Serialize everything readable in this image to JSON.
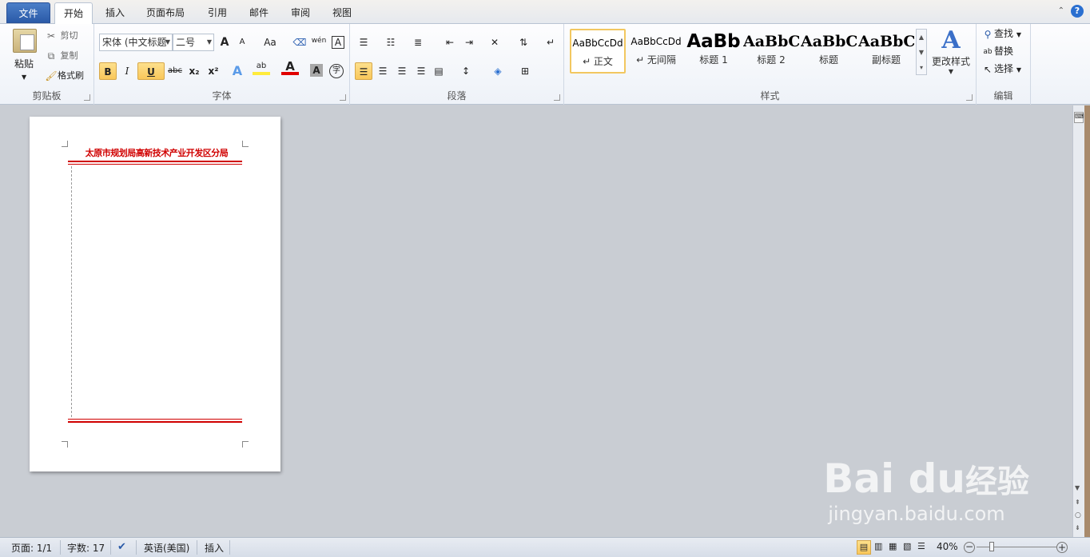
{
  "tabs": [
    "文件",
    "开始",
    "插入",
    "页面布局",
    "引用",
    "邮件",
    "审阅",
    "视图"
  ],
  "clipboard": {
    "paste": "粘贴",
    "cut": "剪切",
    "copy": "复制",
    "format_painter": "格式刷",
    "label": "剪贴板"
  },
  "font": {
    "name": "宋体 (中文标题",
    "size": "二号",
    "label": "字体",
    "grow": "A",
    "shrink": "A",
    "case": "Aa",
    "bold": "B",
    "italic": "I",
    "underline": "U",
    "strike": "abc",
    "sub": "x₂",
    "sup": "x²",
    "pinyin": "wén",
    "border_char": "A",
    "text_effect": "A",
    "highlight": "ab",
    "font_color": "A",
    "shading": "A",
    "enclose": "字"
  },
  "paragraph": {
    "label": "段落"
  },
  "styles": {
    "label": "样式",
    "items": [
      {
        "preview": "AaBbCcDd",
        "name": "↵ 正文"
      },
      {
        "preview": "AaBbCcDd",
        "name": "↵ 无间隔"
      },
      {
        "preview": "AaBb",
        "name": "标题 1"
      },
      {
        "preview": "AaBbC",
        "name": "标题 2"
      },
      {
        "preview": "AaBbC",
        "name": "标题"
      },
      {
        "preview": "AaBbC",
        "name": "副标题"
      }
    ],
    "change": "更改样式"
  },
  "editing": {
    "label": "编辑",
    "find": "查找",
    "replace": "替换",
    "select": "选择"
  },
  "document": {
    "heading": "太原市规划局高新技术产业开发区分局"
  },
  "status": {
    "page": "页面: 1/1",
    "words": "字数: 17",
    "lang": "英语(美国)",
    "mode": "插入",
    "zoom": "40%"
  },
  "watermark": {
    "brand": "Bai du",
    "brand_cn": "经验",
    "url": "jingyan.baidu.com"
  },
  "colors": {
    "accent_red": "#d00000",
    "file_tab": "#2a5aa8",
    "selected_style": "#f2c760"
  }
}
